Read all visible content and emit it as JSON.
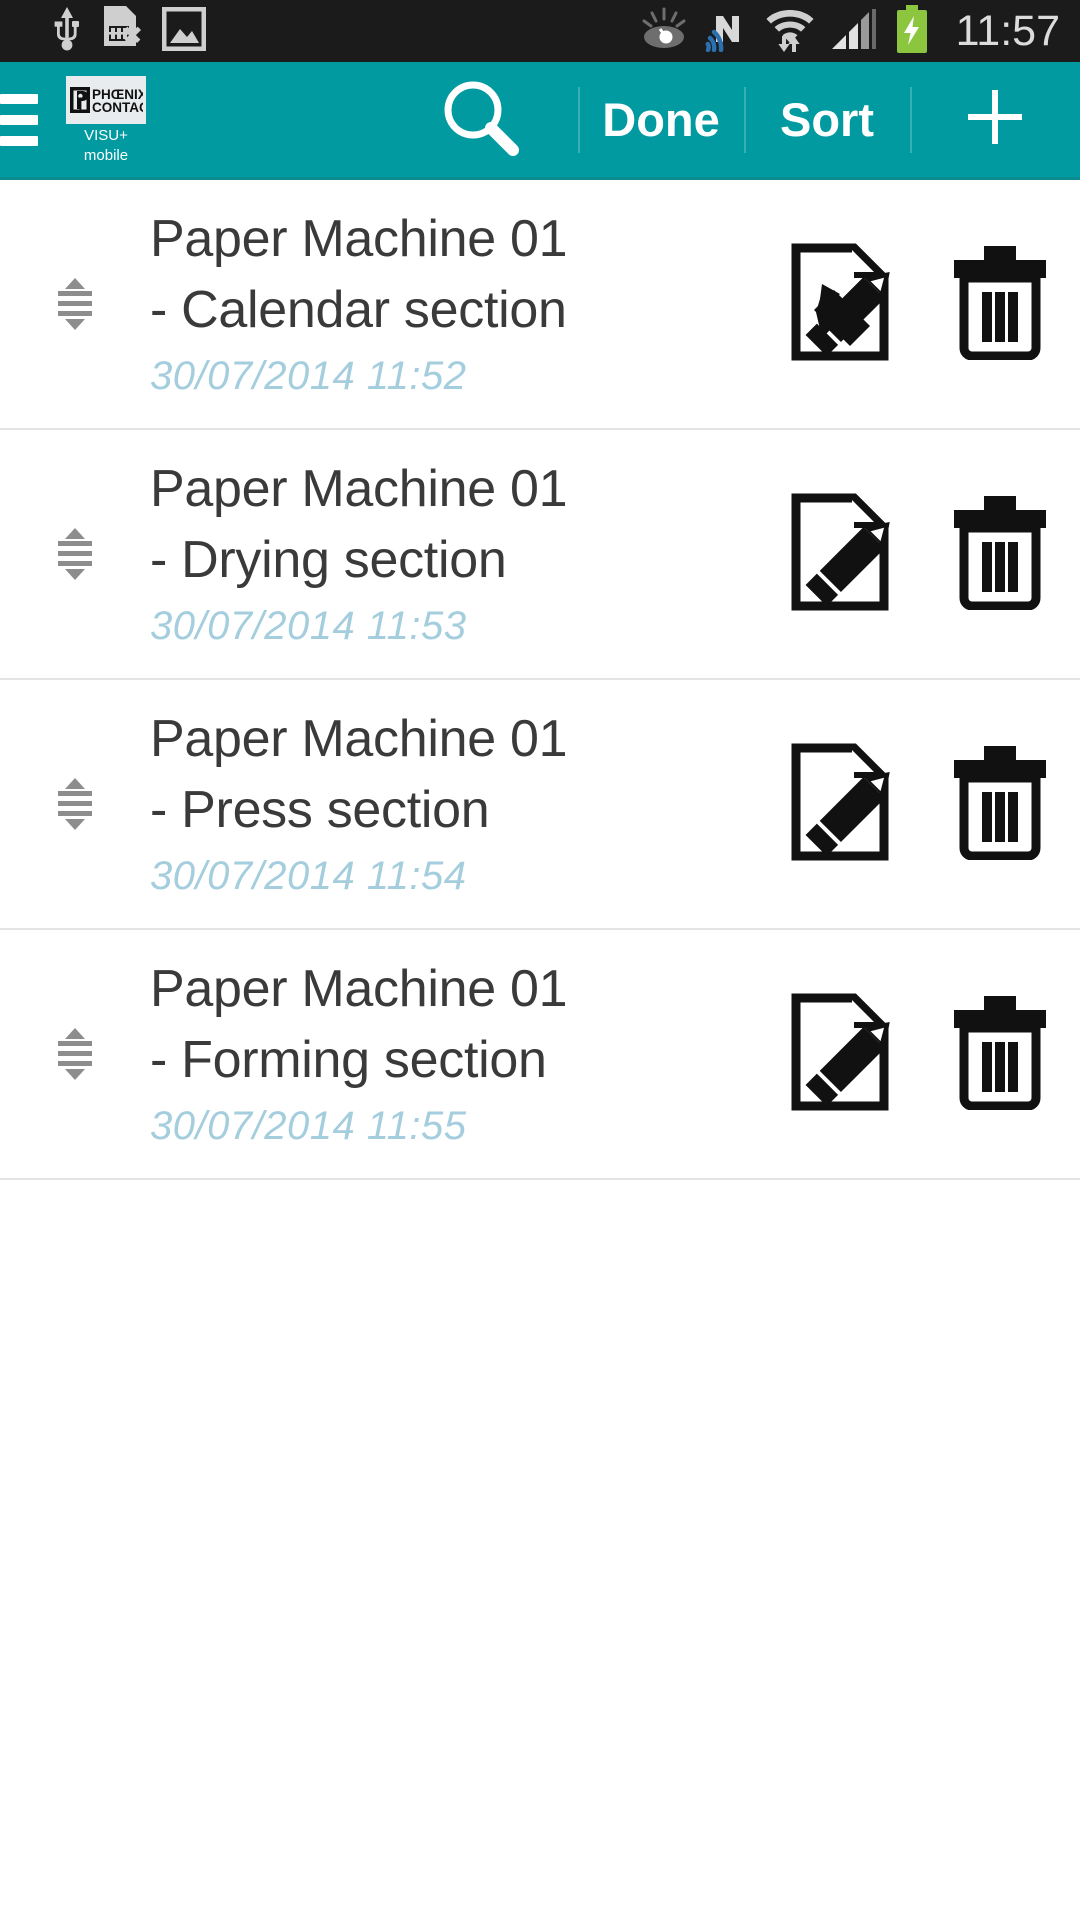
{
  "status_bar": {
    "time": "11:57",
    "left_icons": [
      "usb-icon",
      "sim-card-missing-icon",
      "image-icon"
    ],
    "right_icons": [
      "smart-stay-eye-icon",
      "nfc-icon",
      "wifi-icon",
      "signal-bars-icon",
      "battery-charging-icon"
    ]
  },
  "app_bar": {
    "background": "#009aa0",
    "menu_icon": "hamburger-menu-icon",
    "brand": {
      "logo_text_line1": "PHŒNIX",
      "logo_text_line2": "CONTACT",
      "subtitle_line1": "VISU+",
      "subtitle_line2": "mobile"
    },
    "actions": [
      {
        "name": "search",
        "label": "",
        "icon": "search-icon"
      },
      {
        "name": "done",
        "label": "Done",
        "icon": ""
      },
      {
        "name": "sort",
        "label": "Sort",
        "icon": ""
      },
      {
        "name": "add",
        "label": "",
        "icon": "plus-icon"
      }
    ]
  },
  "list": {
    "rows": [
      {
        "title_line1": "Paper Machine 01",
        "title_line2": "- Calendar section",
        "date": "30/07/2014  11:52",
        "handle_icon": "drag-handle-icon",
        "edit_icon": "document-edit-icon",
        "delete_icon": "trash-icon"
      },
      {
        "title_line1": "Paper Machine 01",
        "title_line2": "- Drying section",
        "date": "30/07/2014  11:53",
        "handle_icon": "drag-handle-icon",
        "edit_icon": "document-edit-icon",
        "delete_icon": "trash-icon"
      },
      {
        "title_line1": "Paper Machine 01",
        "title_line2": "- Press section",
        "date": "30/07/2014  11:54",
        "handle_icon": "drag-handle-icon",
        "edit_icon": "document-edit-icon",
        "delete_icon": "trash-icon"
      },
      {
        "title_line1": "Paper Machine 01",
        "title_line2": "- Forming section",
        "date": "30/07/2014  11:55",
        "handle_icon": "drag-handle-icon",
        "edit_icon": "document-edit-icon",
        "delete_icon": "trash-icon"
      }
    ]
  },
  "colors": {
    "accent_teal": "#009aa0",
    "date_blue": "#a4cddd",
    "title_gray": "#3a3a3a",
    "statusbar_black": "#1b1b1b",
    "battery_green": "#8cc63e"
  }
}
